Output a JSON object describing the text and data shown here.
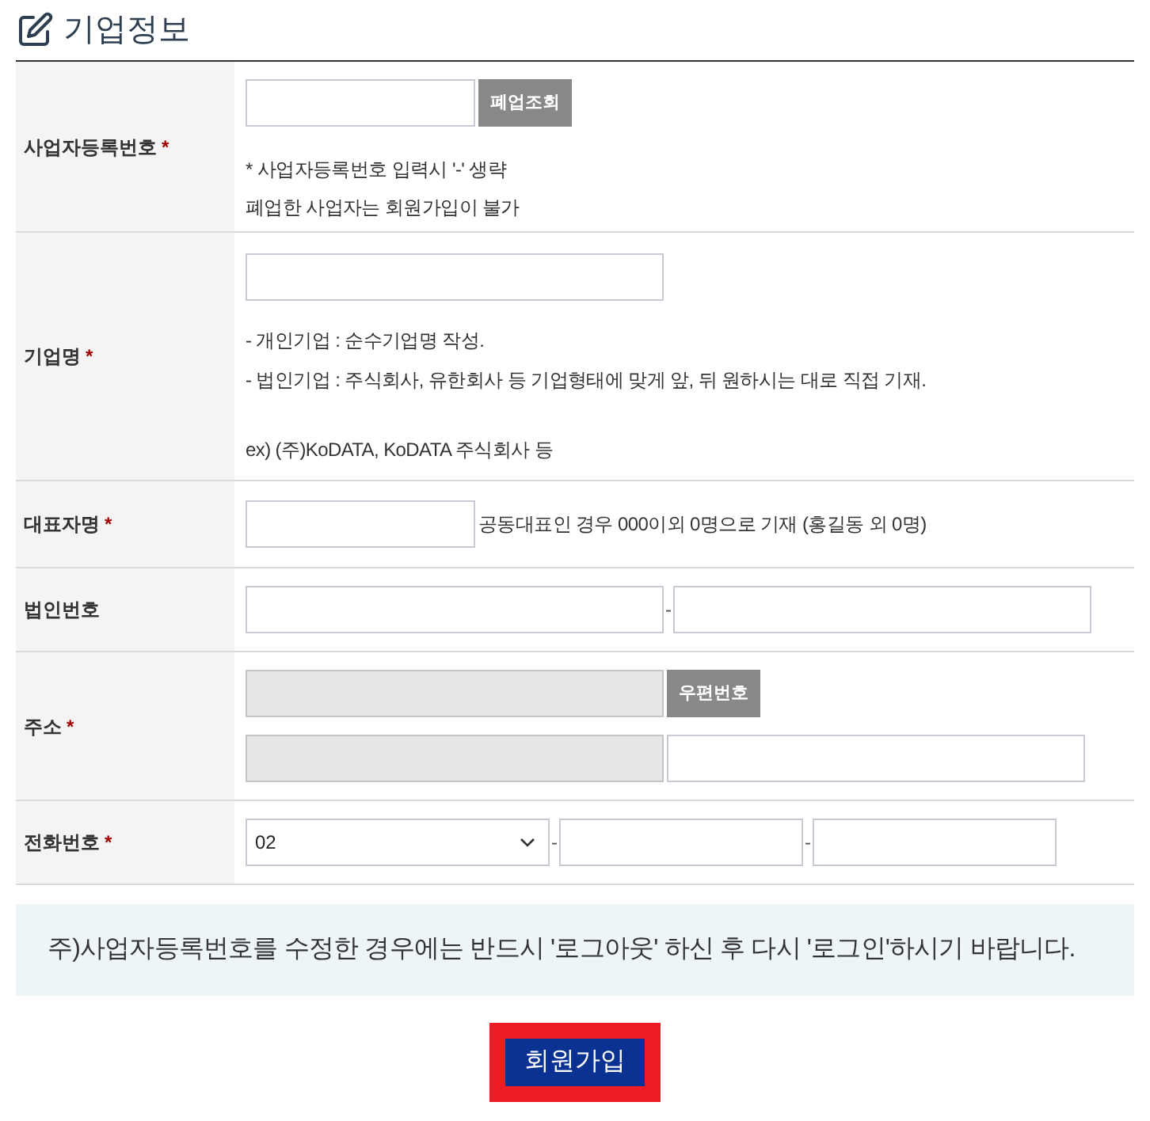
{
  "section": {
    "title": "기업정보"
  },
  "form_rows": [
    {
      "kind": "lookup",
      "label": "사업자등록번호",
      "required_mark": "*",
      "button": "폐업조회",
      "notes": [
        "* 사업자등록번호 입력시 '-' 생략",
        "폐업한 사업자는 회원가입이 불가"
      ]
    },
    {
      "kind": "company",
      "label": "기업명",
      "required_mark": "*",
      "note_groups": [
        [
          "- 개인기업 : 순수기업명 작성.",
          "- 법인기업 : 주식회사, 유한회사 등 기업형태에 맞게 앞, 뒤 원하시는 대로 직접 기재."
        ],
        [
          "ex) (주)KoDATA, KoDATA 주식회사 등"
        ]
      ]
    },
    {
      "kind": "hinted",
      "label": "대표자명",
      "required_mark": "*",
      "hint": "공동대표인 경우 000이외 0명으로 기재 (홍길동 외 0명)"
    },
    {
      "kind": "split",
      "label": "법인번호",
      "separator": "-"
    },
    {
      "kind": "address",
      "label": "주소",
      "required_mark": "*",
      "button": "우편번호",
      "fields": [
        {
          "disabled": true
        },
        {
          "disabled": true
        },
        {
          "disabled": false
        }
      ]
    },
    {
      "kind": "phone",
      "label": "전화번호",
      "required_mark": "*",
      "select": {
        "value": "02"
      },
      "separators": [
        "-",
        "-"
      ]
    }
  ],
  "notice": {
    "text": "주)사업자등록번호를 수정한 경우에는 반드시 '로그아웃' 하신 후 다시 '로그인'하시기 바랍니다."
  },
  "submit": {
    "label": "회원가입",
    "highlighted": true
  }
}
